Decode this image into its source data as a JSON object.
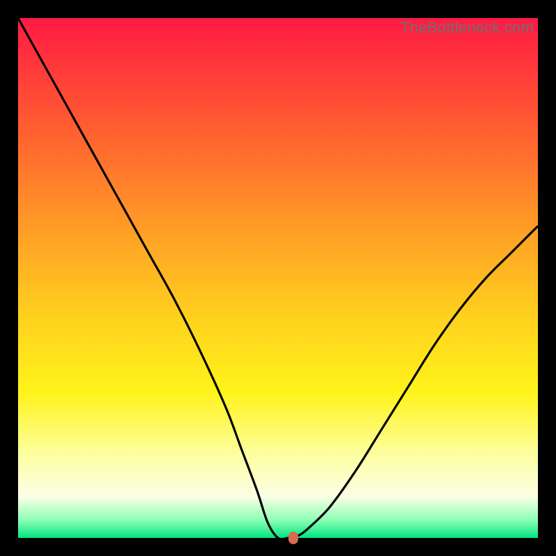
{
  "watermark": "TheBottleneck.com",
  "colors": {
    "page_bg": "#000000",
    "curve": "#000000",
    "marker": "#d86a52"
  },
  "chart_data": {
    "type": "line",
    "title": "",
    "xlabel": "",
    "ylabel": "",
    "xlim": [
      0,
      100
    ],
    "ylim": [
      0,
      100
    ],
    "series": [
      {
        "name": "bottleneck-curve",
        "x": [
          0,
          5,
          10,
          15,
          20,
          25,
          30,
          35,
          40,
          43,
          46,
          48,
          50,
          52,
          54,
          56,
          60,
          65,
          70,
          75,
          80,
          85,
          90,
          95,
          100
        ],
        "y": [
          100,
          91,
          82,
          73,
          64,
          55,
          46,
          36,
          25,
          17,
          9,
          3,
          0,
          0,
          0.5,
          2,
          6,
          13,
          21,
          29,
          37,
          44,
          50,
          55,
          60
        ]
      }
    ],
    "marker": {
      "x": 53,
      "y": 0
    }
  }
}
